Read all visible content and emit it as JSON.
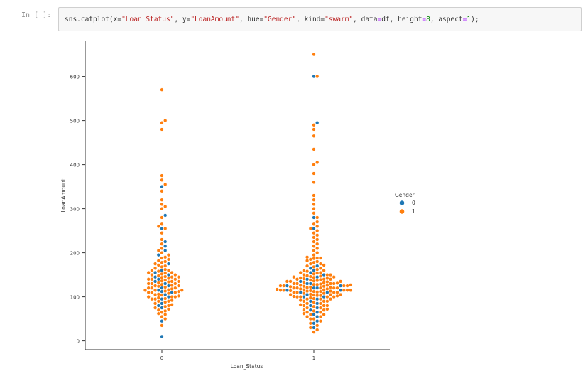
{
  "cell": {
    "prompt": "In [ ]:",
    "code_parts": [
      {
        "t": "sns.catplot(x=",
        "c": "plain"
      },
      {
        "t": "\"Loan_Status\"",
        "c": "str"
      },
      {
        "t": ", y=",
        "c": "plain"
      },
      {
        "t": "\"LoanAmount\"",
        "c": "str"
      },
      {
        "t": ", hue=",
        "c": "plain"
      },
      {
        "t": "\"Gender\"",
        "c": "str"
      },
      {
        "t": ", kind=",
        "c": "plain"
      },
      {
        "t": "\"swarm\"",
        "c": "str"
      },
      {
        "t": ", data",
        "c": "plain"
      },
      {
        "t": "=",
        "c": "op"
      },
      {
        "t": "df, height",
        "c": "plain"
      },
      {
        "t": "=",
        "c": "op"
      },
      {
        "t": "8",
        "c": "num"
      },
      {
        "t": ", aspect",
        "c": "plain"
      },
      {
        "t": "=",
        "c": "op"
      },
      {
        "t": "1",
        "c": "num"
      },
      {
        "t": ");",
        "c": "plain"
      }
    ]
  },
  "chart_data": {
    "type": "scatter",
    "kind": "swarm",
    "xlabel": "Loan_Status",
    "ylabel": "LoanAmount",
    "categories": [
      "0",
      "1"
    ],
    "ylim": [
      -20,
      680
    ],
    "yticks": [
      0,
      100,
      200,
      300,
      400,
      500,
      600
    ],
    "legend": {
      "title": "Gender",
      "placement": "right",
      "entries": [
        {
          "label": "0",
          "color": "#1f77b4"
        },
        {
          "label": "1",
          "color": "#ff7f0e"
        }
      ]
    },
    "series": [
      {
        "name": "0",
        "color": "#1f77b4",
        "values": {
          "0": [
            10,
            45,
            75,
            80,
            85,
            95,
            100,
            105,
            110,
            112,
            115,
            120,
            125,
            130,
            135,
            140,
            145,
            150,
            155,
            160,
            175,
            195,
            205,
            215,
            225,
            255,
            285,
            350
          ],
          "1": [
            30,
            40,
            45,
            55,
            60,
            65,
            70,
            75,
            80,
            85,
            90,
            95,
            100,
            100,
            105,
            110,
            110,
            115,
            115,
            120,
            120,
            125,
            125,
            130,
            130,
            135,
            140,
            145,
            150,
            155,
            160,
            165,
            170,
            255,
            280,
            495,
            600
          ]
        }
      },
      {
        "name": "1",
        "color": "#ff7f0e",
        "values": {
          "0": [
            35,
            50,
            55,
            60,
            62,
            65,
            68,
            70,
            72,
            75,
            78,
            80,
            82,
            85,
            88,
            90,
            90,
            92,
            95,
            95,
            96,
            98,
            100,
            100,
            100,
            102,
            104,
            105,
            106,
            108,
            110,
            110,
            110,
            112,
            113,
            115,
            115,
            115,
            116,
            118,
            120,
            120,
            120,
            122,
            124,
            125,
            125,
            126,
            128,
            130,
            130,
            130,
            132,
            134,
            135,
            135,
            136,
            138,
            140,
            140,
            140,
            142,
            144,
            145,
            145,
            146,
            148,
            150,
            150,
            152,
            154,
            155,
            155,
            158,
            160,
            160,
            162,
            165,
            168,
            170,
            172,
            175,
            178,
            180,
            182,
            185,
            188,
            190,
            195,
            200,
            205,
            210,
            220,
            230,
            245,
            255,
            260,
            265,
            280,
            300,
            305,
            310,
            320,
            340,
            355,
            365,
            375,
            480,
            495,
            500,
            570
          ],
          "1": [
            20,
            25,
            30,
            35,
            40,
            45,
            50,
            50,
            55,
            55,
            60,
            60,
            62,
            65,
            65,
            68,
            70,
            70,
            72,
            75,
            75,
            78,
            80,
            80,
            80,
            82,
            85,
            85,
            88,
            90,
            90,
            90,
            92,
            95,
            95,
            95,
            96,
            98,
            100,
            100,
            100,
            100,
            101,
            102,
            103,
            103,
            104,
            105,
            105,
            105,
            106,
            108,
            108,
            110,
            110,
            110,
            110,
            111,
            112,
            112,
            113,
            113,
            114,
            114,
            115,
            115,
            115,
            115,
            115,
            116,
            116,
            117,
            118,
            118,
            120,
            120,
            120,
            120,
            120,
            121,
            122,
            122,
            123,
            124,
            124,
            125,
            125,
            125,
            125,
            126,
            126,
            127,
            128,
            128,
            129,
            130,
            130,
            130,
            130,
            131,
            132,
            133,
            134,
            135,
            135,
            135,
            136,
            137,
            138,
            139,
            140,
            140,
            140,
            141,
            142,
            143,
            144,
            145,
            145,
            146,
            147,
            148,
            150,
            150,
            150,
            152,
            154,
            155,
            155,
            158,
            160,
            160,
            162,
            165,
            168,
            170,
            172,
            175,
            175,
            178,
            180,
            182,
            185,
            187,
            188,
            188,
            190,
            195,
            200,
            205,
            210,
            215,
            220,
            225,
            230,
            235,
            240,
            245,
            250,
            255,
            260,
            265,
            270,
            280,
            290,
            300,
            310,
            320,
            330,
            360,
            380,
            400,
            405,
            435,
            465,
            480,
            490,
            600,
            650
          ]
        }
      }
    ]
  }
}
